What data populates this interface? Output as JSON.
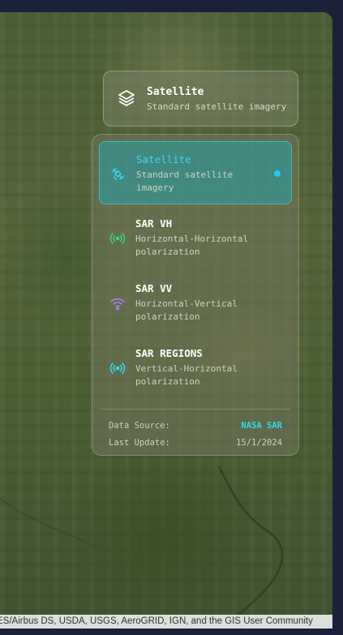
{
  "map": {
    "attribution": "ES/Airbus DS, USDA, USGS, AeroGRID, IGN, and the GIS User Community"
  },
  "current_layer": {
    "title": "Satellite",
    "subtitle": "Standard satellite imagery",
    "icon": "layers-icon"
  },
  "layer_options": [
    {
      "title": "Satellite",
      "subtitle": "Standard satellite imagery",
      "icon": "satellite-icon",
      "active": true,
      "color": "#38d7f0"
    },
    {
      "title": "SAR VH",
      "subtitle": "Horizontal-Horizontal polarization",
      "icon": "broadcast-icon",
      "active": false,
      "color": "#3fd07a"
    },
    {
      "title": "SAR VV",
      "subtitle": "Horizontal-Vertical polarization",
      "icon": "wifi-icon",
      "active": false,
      "color": "#b57cf0"
    },
    {
      "title": "SAR REGIONS",
      "subtitle": "Vertical-Horizontal polarization",
      "icon": "radio-icon",
      "active": false,
      "color": "#38d7f0"
    }
  ],
  "info": {
    "source_label": "Data Source:",
    "source_value": "NASA SAR",
    "update_label": "Last Update:",
    "update_value": "15/1/2024"
  }
}
